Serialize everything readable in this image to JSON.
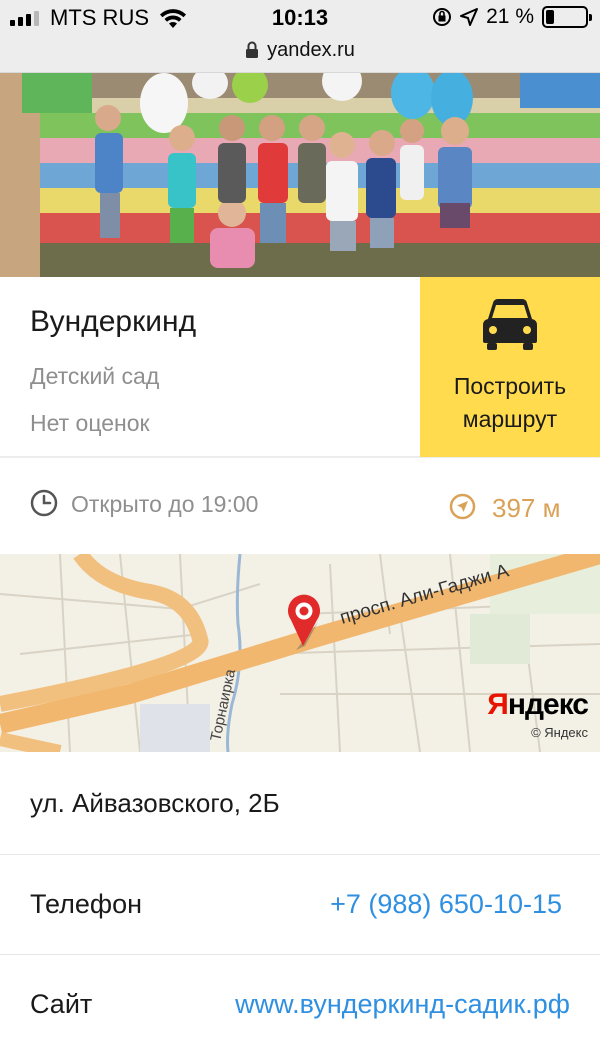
{
  "status_bar": {
    "carrier": "MTS RUS",
    "time": "10:13",
    "battery_percent": "21 %",
    "battery_level": 0.21
  },
  "url_bar": {
    "domain": "yandex.ru"
  },
  "organization": {
    "name": "Вундеркинд",
    "category": "Детский сад",
    "rating": "Нет оценок",
    "route_button": [
      "Построить",
      "маршрут"
    ]
  },
  "hours": {
    "text": "Открыто до 19:00"
  },
  "distance": {
    "text": "397 м"
  },
  "map": {
    "street_main": "просп. Али-Гаджи А",
    "street_side": "Торнаирка",
    "logo_first": "Я",
    "logo_rest": "ндекс",
    "copyright": "© Яндекс"
  },
  "details": {
    "address": "ул. Айвазовского, 2Б",
    "phone_label": "Телефон",
    "phone_value": "+7 (988) 650-10-15",
    "site_label": "Сайт",
    "site_value": "www.вундеркинд-садик.рф"
  },
  "colors": {
    "accent_yellow": "#ffdb4d",
    "link_blue": "#2f8fe0",
    "distance_orange": "#d9a257",
    "yandex_red": "#e61400",
    "muted_gray": "#8f8f8f"
  },
  "icons": [
    "wifi-icon",
    "orientation-lock-icon",
    "location-arrow-icon",
    "battery-icon",
    "lock-icon",
    "car-icon",
    "clock-icon",
    "distance-arrow-icon",
    "map-pin-icon"
  ]
}
